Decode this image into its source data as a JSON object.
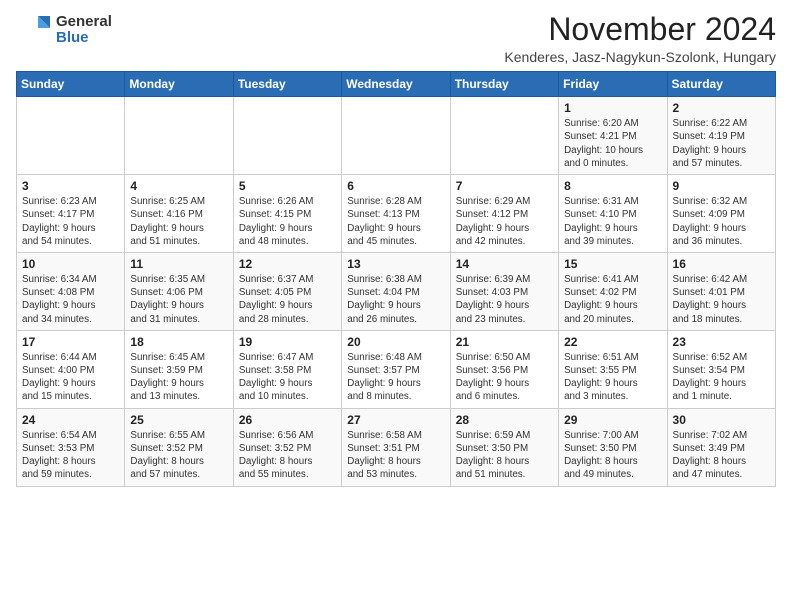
{
  "logo": {
    "general": "General",
    "blue": "Blue"
  },
  "title": "November 2024",
  "location": "Kenderes, Jasz-Nagykun-Szolonk, Hungary",
  "days_of_week": [
    "Sunday",
    "Monday",
    "Tuesday",
    "Wednesday",
    "Thursday",
    "Friday",
    "Saturday"
  ],
  "weeks": [
    [
      {
        "day": "",
        "info": ""
      },
      {
        "day": "",
        "info": ""
      },
      {
        "day": "",
        "info": ""
      },
      {
        "day": "",
        "info": ""
      },
      {
        "day": "",
        "info": ""
      },
      {
        "day": "1",
        "info": "Sunrise: 6:20 AM\nSunset: 4:21 PM\nDaylight: 10 hours\nand 0 minutes."
      },
      {
        "day": "2",
        "info": "Sunrise: 6:22 AM\nSunset: 4:19 PM\nDaylight: 9 hours\nand 57 minutes."
      }
    ],
    [
      {
        "day": "3",
        "info": "Sunrise: 6:23 AM\nSunset: 4:17 PM\nDaylight: 9 hours\nand 54 minutes."
      },
      {
        "day": "4",
        "info": "Sunrise: 6:25 AM\nSunset: 4:16 PM\nDaylight: 9 hours\nand 51 minutes."
      },
      {
        "day": "5",
        "info": "Sunrise: 6:26 AM\nSunset: 4:15 PM\nDaylight: 9 hours\nand 48 minutes."
      },
      {
        "day": "6",
        "info": "Sunrise: 6:28 AM\nSunset: 4:13 PM\nDaylight: 9 hours\nand 45 minutes."
      },
      {
        "day": "7",
        "info": "Sunrise: 6:29 AM\nSunset: 4:12 PM\nDaylight: 9 hours\nand 42 minutes."
      },
      {
        "day": "8",
        "info": "Sunrise: 6:31 AM\nSunset: 4:10 PM\nDaylight: 9 hours\nand 39 minutes."
      },
      {
        "day": "9",
        "info": "Sunrise: 6:32 AM\nSunset: 4:09 PM\nDaylight: 9 hours\nand 36 minutes."
      }
    ],
    [
      {
        "day": "10",
        "info": "Sunrise: 6:34 AM\nSunset: 4:08 PM\nDaylight: 9 hours\nand 34 minutes."
      },
      {
        "day": "11",
        "info": "Sunrise: 6:35 AM\nSunset: 4:06 PM\nDaylight: 9 hours\nand 31 minutes."
      },
      {
        "day": "12",
        "info": "Sunrise: 6:37 AM\nSunset: 4:05 PM\nDaylight: 9 hours\nand 28 minutes."
      },
      {
        "day": "13",
        "info": "Sunrise: 6:38 AM\nSunset: 4:04 PM\nDaylight: 9 hours\nand 26 minutes."
      },
      {
        "day": "14",
        "info": "Sunrise: 6:39 AM\nSunset: 4:03 PM\nDaylight: 9 hours\nand 23 minutes."
      },
      {
        "day": "15",
        "info": "Sunrise: 6:41 AM\nSunset: 4:02 PM\nDaylight: 9 hours\nand 20 minutes."
      },
      {
        "day": "16",
        "info": "Sunrise: 6:42 AM\nSunset: 4:01 PM\nDaylight: 9 hours\nand 18 minutes."
      }
    ],
    [
      {
        "day": "17",
        "info": "Sunrise: 6:44 AM\nSunset: 4:00 PM\nDaylight: 9 hours\nand 15 minutes."
      },
      {
        "day": "18",
        "info": "Sunrise: 6:45 AM\nSunset: 3:59 PM\nDaylight: 9 hours\nand 13 minutes."
      },
      {
        "day": "19",
        "info": "Sunrise: 6:47 AM\nSunset: 3:58 PM\nDaylight: 9 hours\nand 10 minutes."
      },
      {
        "day": "20",
        "info": "Sunrise: 6:48 AM\nSunset: 3:57 PM\nDaylight: 9 hours\nand 8 minutes."
      },
      {
        "day": "21",
        "info": "Sunrise: 6:50 AM\nSunset: 3:56 PM\nDaylight: 9 hours\nand 6 minutes."
      },
      {
        "day": "22",
        "info": "Sunrise: 6:51 AM\nSunset: 3:55 PM\nDaylight: 9 hours\nand 3 minutes."
      },
      {
        "day": "23",
        "info": "Sunrise: 6:52 AM\nSunset: 3:54 PM\nDaylight: 9 hours\nand 1 minute."
      }
    ],
    [
      {
        "day": "24",
        "info": "Sunrise: 6:54 AM\nSunset: 3:53 PM\nDaylight: 8 hours\nand 59 minutes."
      },
      {
        "day": "25",
        "info": "Sunrise: 6:55 AM\nSunset: 3:52 PM\nDaylight: 8 hours\nand 57 minutes."
      },
      {
        "day": "26",
        "info": "Sunrise: 6:56 AM\nSunset: 3:52 PM\nDaylight: 8 hours\nand 55 minutes."
      },
      {
        "day": "27",
        "info": "Sunrise: 6:58 AM\nSunset: 3:51 PM\nDaylight: 8 hours\nand 53 minutes."
      },
      {
        "day": "28",
        "info": "Sunrise: 6:59 AM\nSunset: 3:50 PM\nDaylight: 8 hours\nand 51 minutes."
      },
      {
        "day": "29",
        "info": "Sunrise: 7:00 AM\nSunset: 3:50 PM\nDaylight: 8 hours\nand 49 minutes."
      },
      {
        "day": "30",
        "info": "Sunrise: 7:02 AM\nSunset: 3:49 PM\nDaylight: 8 hours\nand 47 minutes."
      }
    ]
  ]
}
